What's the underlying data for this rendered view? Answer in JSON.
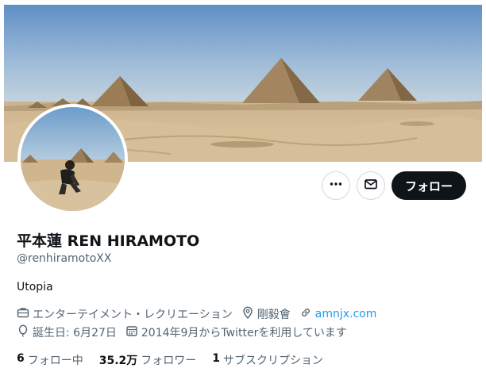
{
  "profile": {
    "display_name": "平本蓮 REN HIRAMOTO",
    "handle": "@renhiramotoXX",
    "bio": "Utopia"
  },
  "actions": {
    "more_icon": "more-horizontal-icon",
    "message_icon": "envelope-icon",
    "follow_label": "フォロー"
  },
  "meta": {
    "category": "エンターテイメント・レクリエーション",
    "location": "剛毅會",
    "website": "amnjx.com",
    "birthday": "誕生日: 6月27日",
    "joined": "2014年9月からTwitterを利用しています"
  },
  "stats": {
    "following_count": "6",
    "following_label": "フォロー中",
    "followers_count": "35.2万",
    "followers_label": "フォロワー",
    "subscriptions_count": "1",
    "subscriptions_label": "サブスクリプション"
  },
  "colors": {
    "accent": "#1d9bf0",
    "follow_button_bg": "#0f1419",
    "secondary_text": "#536471"
  }
}
